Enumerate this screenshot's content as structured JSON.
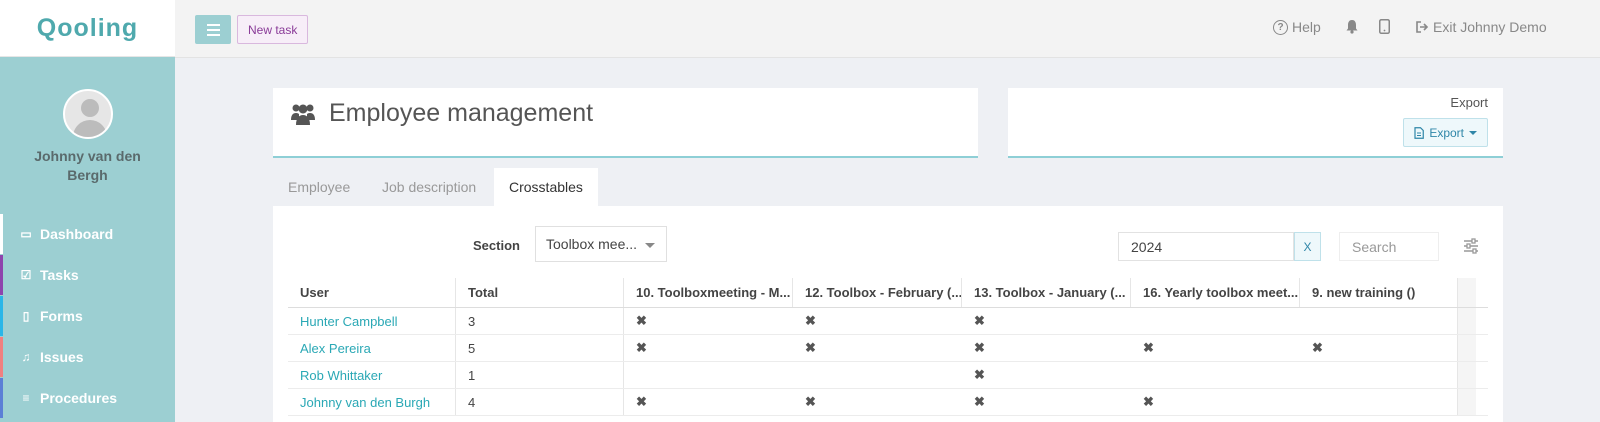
{
  "app": {
    "logo": "Qooling"
  },
  "sidebar": {
    "user_name": "Johnny van den Bergh",
    "items": [
      {
        "label": "Dashboard",
        "icon": "monitor-icon",
        "accent": "#ffffff"
      },
      {
        "label": "Tasks",
        "icon": "check-square-icon",
        "accent": "#8e44ad"
      },
      {
        "label": "Forms",
        "icon": "file-icon",
        "accent": "#29b6e8"
      },
      {
        "label": "Issues",
        "icon": "bell-icon",
        "accent": "#f08080"
      },
      {
        "label": "Procedures",
        "icon": "list-icon",
        "accent": "#5b7fd6"
      }
    ]
  },
  "topbar": {
    "new_task_label": "New task",
    "help_label": "Help",
    "exit_label": "Exit Johnny Demo"
  },
  "page": {
    "title": "Employee management",
    "export_heading": "Export",
    "export_button": "Export"
  },
  "tabs": [
    {
      "label": "Employee",
      "active": false
    },
    {
      "label": "Job description",
      "active": false
    },
    {
      "label": "Crosstables",
      "active": true
    }
  ],
  "filters": {
    "section_label": "Section",
    "section_value": "Toolbox mee...",
    "year_value": "2024",
    "clear_label": "X",
    "search_placeholder": "Search"
  },
  "table": {
    "columns": [
      "User",
      "Total",
      "10. Toolboxmeeting - M...",
      "12. Toolbox - February (...",
      "13. Toolbox - January (...",
      "16. Yearly toolbox meet...",
      "9. new training ()"
    ],
    "mark_symbol": "✖",
    "rows": [
      {
        "user": "Hunter Campbell",
        "total": "3",
        "marks": [
          true,
          true,
          true,
          false,
          false
        ]
      },
      {
        "user": "Alex Pereira",
        "total": "5",
        "marks": [
          true,
          true,
          true,
          true,
          true
        ]
      },
      {
        "user": "Rob Whittaker",
        "total": "1",
        "marks": [
          false,
          false,
          true,
          false,
          false
        ]
      },
      {
        "user": "Johnny van den Burgh",
        "total": "4",
        "marks": [
          true,
          true,
          true,
          true,
          false
        ]
      }
    ]
  }
}
